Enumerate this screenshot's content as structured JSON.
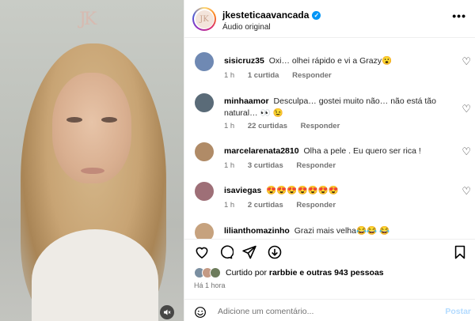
{
  "media": {
    "watermark": "JK",
    "mute_icon": "speaker-muted-icon"
  },
  "header": {
    "username": "jkesteticaavancada",
    "verified_glyph": "✓",
    "subtitle": "Áudio original",
    "more_glyph": "•••",
    "avatar_logo": "JK"
  },
  "comments": [
    {
      "user": "sisicruz35",
      "text": "Oxi… olhei rápido e vi a Grazy😮",
      "time": "1 h",
      "likes": "1 curtida",
      "reply": "Responder",
      "avatar_color": "#6f89b3"
    },
    {
      "user": "minhaamor",
      "text": "Desculpa… gostei muito não… não está tão natural… 👀 😉",
      "time": "1 h",
      "likes": "22 curtidas",
      "reply": "Responder",
      "avatar_color": "#5a6b78"
    },
    {
      "user": "marcelarenata2810",
      "text": "Olha a pele . Eu quero ser rica !",
      "time": "1 h",
      "likes": "3 curtidas",
      "reply": "Responder",
      "avatar_color": "#b08b67"
    },
    {
      "user": "isaviegas",
      "text": "😍😍😍😍😍😍😍",
      "time": "1 h",
      "likes": "2 curtidas",
      "reply": "Responder",
      "avatar_color": "#9e6f77"
    },
    {
      "user": "lilianthomazinho",
      "text": "Grazi mais velha😂😂 😂",
      "time": "",
      "likes": "",
      "reply": "",
      "avatar_color": "#c6a27e"
    }
  ],
  "likes": {
    "prefix": "Curtido por",
    "user": "rarbbie",
    "connector": "e",
    "others": "outras 943 pessoas",
    "avatar_colors": [
      "#7b8fa1",
      "#c49a84",
      "#6d7c5c"
    ]
  },
  "timestamp": "Há 1 hora",
  "add_comment": {
    "placeholder": "Adicione um comentário...",
    "post_label": "Postar"
  },
  "colors": {
    "accent": "#0095f6",
    "post_disabled": "#b3dbff",
    "muted_text": "#737373"
  }
}
